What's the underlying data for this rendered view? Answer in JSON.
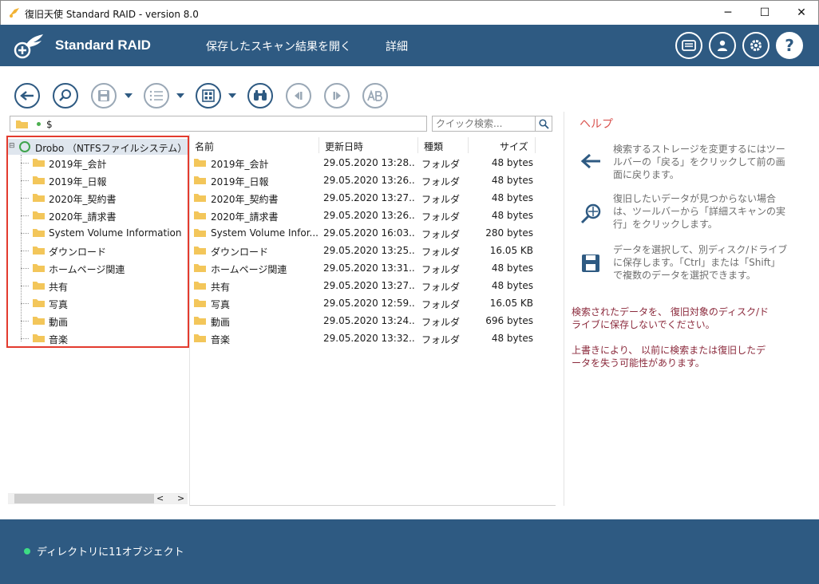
{
  "window": {
    "title": "復旧天使 Standard RAID - version 8.0",
    "minimize": "─",
    "maximize": "☐",
    "close": "✕"
  },
  "header": {
    "brand": "Standard RAID",
    "menu": [
      "保存したスキャン結果を開く",
      "詳細"
    ],
    "help_label": "?"
  },
  "toolbar": {
    "icons": [
      "back-icon",
      "search-scan-icon",
      "save-icon",
      "list-view-icon",
      "grid-view-icon",
      "binoculars-icon",
      "prev-icon",
      "next-icon",
      "ab-icon"
    ]
  },
  "path": {
    "value": "$"
  },
  "search": {
    "placeholder": "クイック検索..."
  },
  "tree": {
    "root": "Drobo （NTFSファイルシステム）",
    "items": [
      "2019年_会計",
      "2019年_日報",
      "2020年_契約書",
      "2020年_請求書",
      "System Volume Information",
      "ダウンロード",
      "ホームページ関連",
      "共有",
      "写真",
      "動画",
      "音楽"
    ]
  },
  "list": {
    "columns": [
      "名前",
      "更新日時",
      "種類",
      "サイズ"
    ],
    "rows": [
      {
        "name": "2019年_会計",
        "date": "29.05.2020 13:28...",
        "type": "フォルダ",
        "size": "48 bytes"
      },
      {
        "name": "2019年_日報",
        "date": "29.05.2020 13:26...",
        "type": "フォルダ",
        "size": "48 bytes"
      },
      {
        "name": "2020年_契約書",
        "date": "29.05.2020 13:27...",
        "type": "フォルダ",
        "size": "48 bytes"
      },
      {
        "name": "2020年_請求書",
        "date": "29.05.2020 13:26...",
        "type": "フォルダ",
        "size": "48 bytes"
      },
      {
        "name": "System Volume Infor...",
        "date": "29.05.2020 16:03...",
        "type": "フォルダ",
        "size": "280 bytes"
      },
      {
        "name": "ダウンロード",
        "date": "29.05.2020 13:25...",
        "type": "フォルダ",
        "size": "16.05 KB"
      },
      {
        "name": "ホームページ関連",
        "date": "29.05.2020 13:31...",
        "type": "フォルダ",
        "size": "48 bytes"
      },
      {
        "name": "共有",
        "date": "29.05.2020 13:27...",
        "type": "フォルダ",
        "size": "48 bytes"
      },
      {
        "name": "写真",
        "date": "29.05.2020 12:59...",
        "type": "フォルダ",
        "size": "16.05 KB"
      },
      {
        "name": "動画",
        "date": "29.05.2020 13:24...",
        "type": "フォルダ",
        "size": "696 bytes"
      },
      {
        "name": "音楽",
        "date": "29.05.2020 13:32...",
        "type": "フォルダ",
        "size": "48 bytes"
      }
    ]
  },
  "help": {
    "title": "ヘルプ",
    "tips": [
      "検索するストレージを変更するにはツールバーの「戻る」をクリックして前の画面に戻ります。",
      "復旧したいデータが見つからない場合は、ツールバーから「詳細スキャンの実行」をクリックします。",
      "データを選択して、別ディスク/ドライブに保存します。「Ctrl」または「Shift」で複数のデータを選択できます。"
    ],
    "warnings": [
      "検索されたデータを、 復旧対象のディスク/ドライブに保存しないでください。",
      "上書きにより、 以前に検索または復旧したデータを失う可能性があります。"
    ]
  },
  "footer": {
    "status": "ディレクトリに11オブジェクト"
  },
  "colors": {
    "brand": "#2e5a82",
    "highlight": "#e33b2e",
    "help_title": "#d9534f",
    "warning": "#8b2a3c"
  }
}
